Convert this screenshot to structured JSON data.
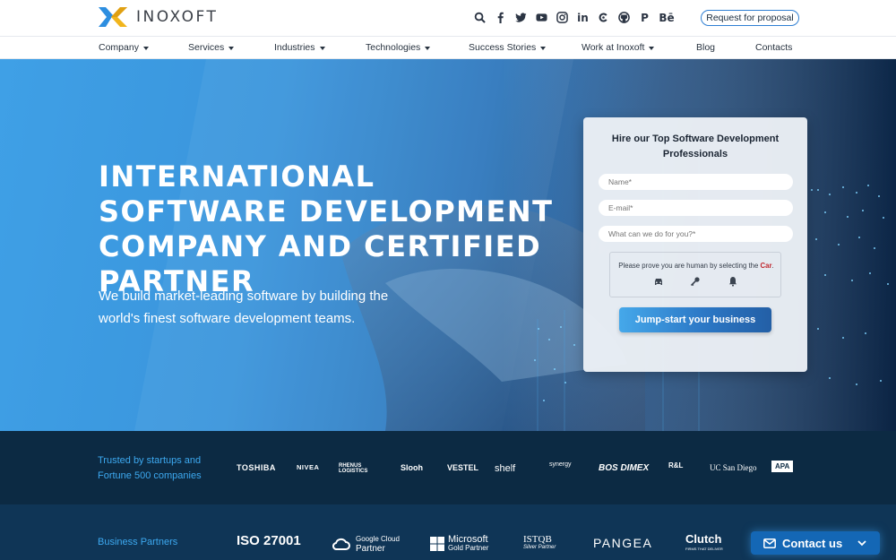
{
  "brand": {
    "name": "INOXOFT"
  },
  "header": {
    "socials": [
      "search-icon",
      "facebook-icon",
      "twitter-icon",
      "youtube-icon",
      "instagram-icon",
      "linkedin-icon",
      "clutch-icon",
      "github-icon",
      "producthunt-icon",
      "behance-icon"
    ],
    "linkedin_glyph": "in",
    "behance_glyph": "Bē",
    "producthunt_glyph": "P",
    "request_label": "Request for proposal"
  },
  "nav": {
    "items": [
      {
        "label": "Company",
        "dropdown": true
      },
      {
        "label": "Services",
        "dropdown": true
      },
      {
        "label": "Industries",
        "dropdown": true
      },
      {
        "label": "Technologies",
        "dropdown": true
      },
      {
        "label": "Success Stories",
        "dropdown": true
      },
      {
        "label": "Work at Inoxoft",
        "dropdown": true
      },
      {
        "label": "Blog",
        "dropdown": false
      },
      {
        "label": "Contacts",
        "dropdown": false
      }
    ]
  },
  "hero": {
    "title": "INTERNATIONAL SOFTWARE DEVELOPMENT COMPANY AND CERTIFIED PARTNER",
    "subtitle": "We build market-leading software by building the world's finest software development teams."
  },
  "form": {
    "title": "Hire our Top Software Development Professionals",
    "name_placeholder": "Name*",
    "email_placeholder": "E-mail*",
    "message_placeholder": "What can we do for you?*",
    "captcha_prefix": "Please prove you are human by selecting the ",
    "captcha_target": "Car",
    "captcha_suffix": ".",
    "captcha_icons": [
      "car-icon",
      "key-icon",
      "bell-icon"
    ],
    "submit_label": "Jump-start your business"
  },
  "trusted": {
    "label": "Trusted by startups and Fortune 500 companies",
    "clients": [
      "TOSHIBA",
      "NIVEA",
      "RHENUS LOGISTICS",
      "Slooh",
      "VESTEL",
      "shelf",
      "synergy",
      "BOS DIMEX",
      "R&L",
      "UC San Diego",
      "APA"
    ]
  },
  "partners": {
    "label": "Business Partners",
    "items": [
      "ISO 27001",
      "Google Cloud Partner",
      "Microsoft Gold Partner",
      "ISTQB Silver Partner",
      "PANGEA",
      "Clutch"
    ],
    "google_top": "Google Cloud",
    "google_bottom": "Partner",
    "microsoft_top": "Microsoft",
    "microsoft_bottom": "Gold Partner",
    "istqb_top": "ISTQB",
    "istqb_bottom": "Silver Partner",
    "clutch_sub": "FIRMS THAT DELIVER"
  },
  "contact_widget": {
    "label": "Contact us"
  },
  "colors": {
    "accent": "#2f7fd3",
    "brand_yellow": "#f1b51c",
    "brand_blue": "#2d8ee0",
    "dark_strip": "#0c2a43",
    "captcha_target": "#c0262d"
  }
}
